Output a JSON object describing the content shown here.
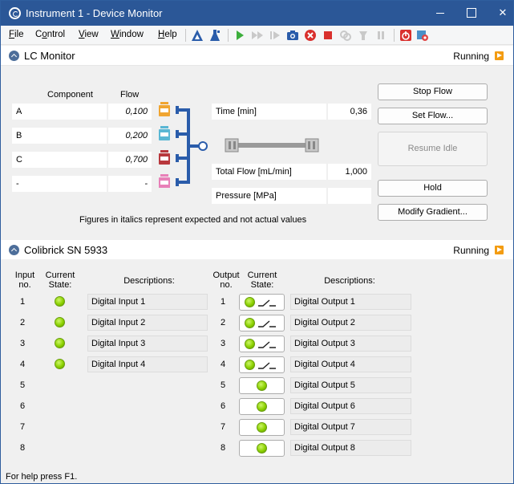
{
  "window": {
    "title": "Instrument 1 - Device Monitor"
  },
  "menu": {
    "items": [
      {
        "pre": "",
        "u": "F",
        "post": "ile"
      },
      {
        "pre": "C",
        "u": "o",
        "post": "ntrol"
      },
      {
        "pre": "",
        "u": "V",
        "post": "iew"
      },
      {
        "pre": "",
        "u": "W",
        "post": "indow"
      },
      {
        "pre": "",
        "u": "H",
        "post": "elp"
      }
    ]
  },
  "lc": {
    "title": "LC Monitor",
    "status": "Running",
    "component_header": "Component",
    "flow_header": "Flow",
    "rows": [
      {
        "name": "A",
        "flow": "0,100",
        "color": "#f0a531"
      },
      {
        "name": "B",
        "flow": "0,200",
        "color": "#5ab7d4"
      },
      {
        "name": "C",
        "flow": "0,700",
        "color": "#b8383d"
      },
      {
        "name": "-",
        "flow": "-",
        "color": "#e880b8"
      }
    ],
    "time_label": "Time [min]",
    "time_value": "0,36",
    "total_flow_label": "Total Flow [mL/min]",
    "total_flow_value": "1,000",
    "pressure_label": "Pressure [MPa]",
    "pressure_value": "",
    "footnote": "Figures in italics represent expected and not actual values",
    "buttons": {
      "stop_flow": "Stop Flow",
      "set_flow": "Set Flow...",
      "resume_idle": "Resume Idle",
      "hold": "Hold",
      "modify_gradient": "Modify Gradient..."
    }
  },
  "colibrick": {
    "title": "Colibrick SN 5933",
    "status": "Running",
    "input_header": "Input\nno.",
    "state_header": "Current\nState:",
    "desc_header": "Descriptions:",
    "output_header": "Output\nno.",
    "inputs": [
      {
        "no": "1",
        "desc": "Digital Input 1",
        "on": true
      },
      {
        "no": "2",
        "desc": "Digital Input 2",
        "on": true
      },
      {
        "no": "3",
        "desc": "Digital Input 3",
        "on": true
      },
      {
        "no": "4",
        "desc": "Digital Input 4",
        "on": true
      },
      {
        "no": "5",
        "desc": "",
        "on": false
      },
      {
        "no": "6",
        "desc": "",
        "on": false
      },
      {
        "no": "7",
        "desc": "",
        "on": false
      },
      {
        "no": "8",
        "desc": "",
        "on": false
      }
    ],
    "outputs": [
      {
        "no": "1",
        "desc": "Digital Output 1",
        "switch": true
      },
      {
        "no": "2",
        "desc": "Digital Output 2",
        "switch": true
      },
      {
        "no": "3",
        "desc": "Digital Output 3",
        "switch": true
      },
      {
        "no": "4",
        "desc": "Digital Output 4",
        "switch": true
      },
      {
        "no": "5",
        "desc": "Digital Output 5",
        "switch": false
      },
      {
        "no": "6",
        "desc": "Digital Output 6",
        "switch": false
      },
      {
        "no": "7",
        "desc": "Digital Output 7",
        "switch": false
      },
      {
        "no": "8",
        "desc": "Digital Output 8",
        "switch": false
      }
    ]
  },
  "statusbar": {
    "text": "For help press F1."
  },
  "colors": {
    "titlebar": "#2b5797",
    "accent_blue": "#2a5caa",
    "led_green": "#8bd100",
    "status_orange": "#f39c12"
  }
}
